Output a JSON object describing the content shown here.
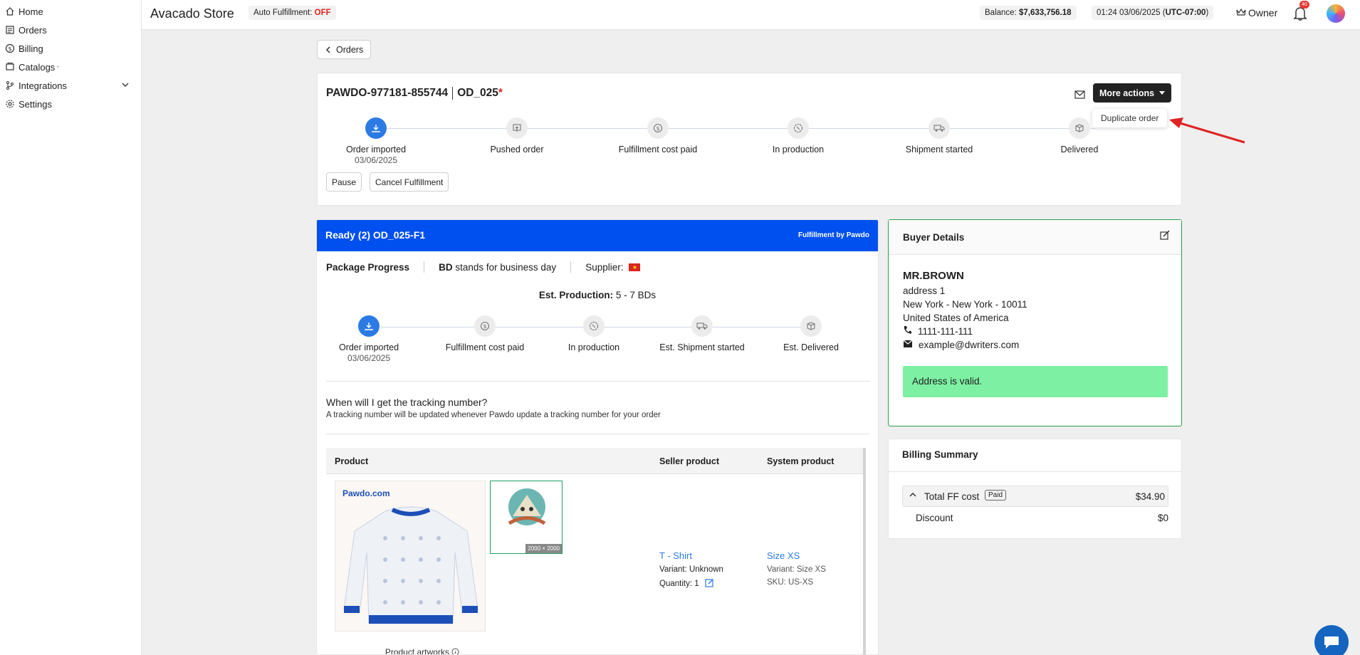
{
  "sidebar": {
    "items": [
      {
        "label": "Home",
        "icon": "home-icon"
      },
      {
        "label": "Orders",
        "icon": "orders-icon"
      },
      {
        "label": "Billing",
        "icon": "dollar-icon"
      },
      {
        "label": "Catalogs",
        "icon": "catalog-icon",
        "sup": "+"
      },
      {
        "label": "Integrations",
        "icon": "branch-icon"
      },
      {
        "label": "Settings",
        "icon": "gear-icon"
      }
    ]
  },
  "topbar": {
    "store_name": "Avacado Store",
    "auto_ff_label": "Auto Fulfillment:",
    "auto_ff_value": "OFF",
    "balance_label": "Balance:",
    "balance_value": "$7,633,756.18",
    "time_value": "01:24 03/06/2025 (",
    "time_zone": "UTC-07:00",
    "time_close": ")",
    "owner_label": "Owner",
    "notif_count": "40"
  },
  "back_label": "Orders",
  "order": {
    "id": "PAWDO-977181-855744",
    "ref": "OD_025",
    "star": "*",
    "more_actions": "More actions",
    "menu_item": "Duplicate order",
    "steps": [
      {
        "label": "Order imported",
        "date": "03/06/2025"
      },
      {
        "label": "Pushed order",
        "date": ""
      },
      {
        "label": "Fulfillment cost paid",
        "date": ""
      },
      {
        "label": "In production",
        "date": ""
      },
      {
        "label": "Shipment started",
        "date": ""
      },
      {
        "label": "Delivered",
        "date": ""
      }
    ],
    "pause": "Pause",
    "cancel": "Cancel Fulfillment"
  },
  "package": {
    "header": "Ready (2) OD_025-F1",
    "fulfilled_by": "Fulfillment by Pawdo",
    "progress_label": "Package Progress",
    "bd_bold": "BD",
    "bd_text": "stands for business day",
    "supplier": "Supplier:",
    "est_label": "Est. Production:",
    "est_value": "5 - 7 BDs",
    "steps": [
      {
        "label": "Order imported",
        "date": "03/06/2025"
      },
      {
        "label": "Fulfillment cost paid",
        "date": ""
      },
      {
        "label": "In production",
        "date": ""
      },
      {
        "label": "Est. Shipment started",
        "date": ""
      },
      {
        "label": "Est. Delivered",
        "date": ""
      }
    ],
    "tracking_q": "When will I get the tracking number?",
    "tracking_d": "A tracking number will be updated whenever Pawdo update a tracking number for your order",
    "table": {
      "col_product": "Product",
      "col_seller": "Seller product",
      "col_system": "System product",
      "brand": "Pawdo.com",
      "art_dim": "2000 × 2000",
      "seller_name": "T - Shirt",
      "seller_variant": "Variant: Unknown",
      "seller_qty": "Quantity: 1",
      "sys_name": "Size XS",
      "sys_variant": "Variant: Size XS",
      "sys_sku": "SKU: US-XS",
      "artworks": "Product artworks"
    }
  },
  "buyer": {
    "title": "Buyer Details",
    "name": "MR.BROWN",
    "address1": "address 1",
    "city": "New York - New York - 10011",
    "country": "United States of America",
    "phone": "1111-111-111",
    "email": "example@dwriters.com",
    "valid": "Address is valid."
  },
  "billing": {
    "title": "Billing Summary",
    "total_label": "Total FF cost",
    "paid": "Paid",
    "total": "$34.90",
    "discount_label": "Discount",
    "discount": "$0"
  },
  "colors": {
    "accent": "#2c7be5",
    "header_blue": "#0050ef",
    "valid_green": "#7df0a3",
    "off_red": "#e02424"
  }
}
